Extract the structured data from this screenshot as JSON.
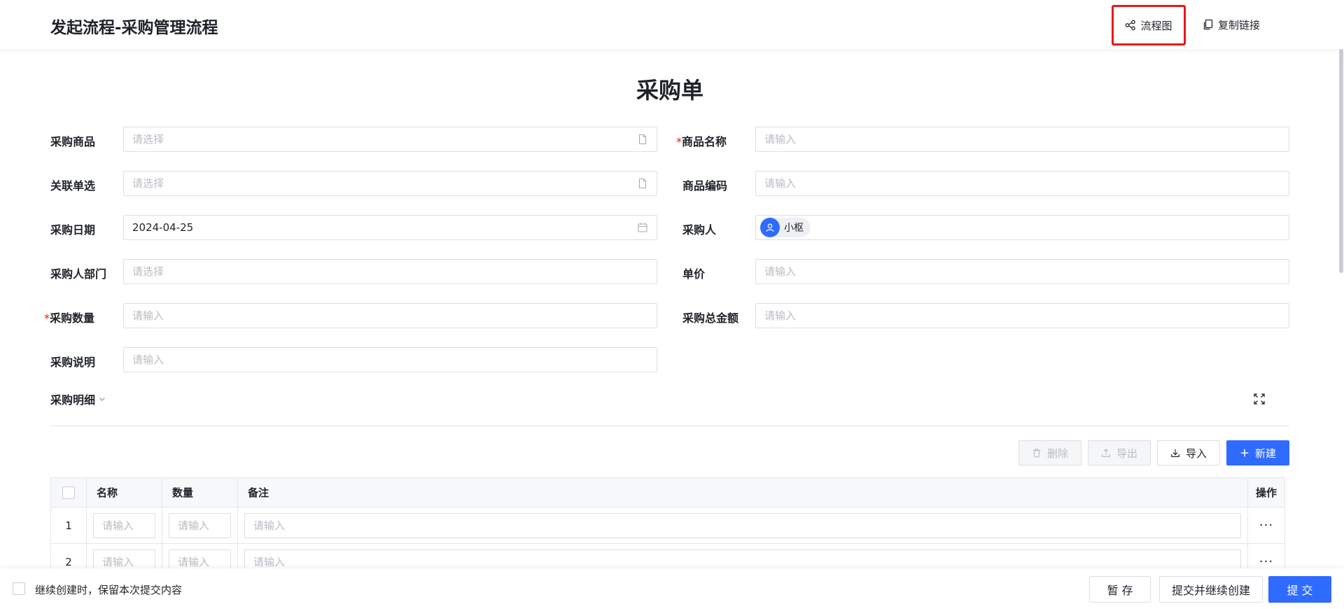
{
  "header": {
    "title": "发起流程-采购管理流程",
    "flowchart_label": "流程图",
    "copy_link_label": "复制链接"
  },
  "form": {
    "title": "采购单",
    "fields": {
      "goods": {
        "label": "采购商品",
        "placeholder": "请选择",
        "value": ""
      },
      "goods_name": {
        "label": "商品名称",
        "required": true,
        "placeholder": "请输入",
        "value": ""
      },
      "related": {
        "label": "关联单选",
        "placeholder": "请选择",
        "value": ""
      },
      "goods_code": {
        "label": "商品编码",
        "placeholder": "请输入",
        "value": ""
      },
      "date": {
        "label": "采购日期",
        "value": "2024-04-25"
      },
      "buyer": {
        "label": "采购人",
        "user": "小枢"
      },
      "dept": {
        "label": "采购人部门",
        "placeholder": "请选择",
        "value": ""
      },
      "unit_price": {
        "label": "单价",
        "placeholder": "请输入",
        "value": ""
      },
      "quantity": {
        "label": "采购数量",
        "required": true,
        "placeholder": "请输入",
        "value": ""
      },
      "total": {
        "label": "采购总金额",
        "placeholder": "请输入",
        "value": ""
      },
      "note": {
        "label": "采购说明",
        "placeholder": "请输入",
        "value": ""
      }
    },
    "required_mark": "*"
  },
  "detail": {
    "title": "采购明细",
    "toolbar": {
      "delete": "删除",
      "export": "导出",
      "import": "导入",
      "add": "新建"
    },
    "columns": [
      "名称",
      "数量",
      "备注",
      "操作"
    ],
    "rows": [
      {
        "index": "1",
        "name_placeholder": "请输入",
        "qty_placeholder": "请输入",
        "note_placeholder": "请输入",
        "op": "···"
      },
      {
        "index": "2",
        "name_placeholder": "请输入",
        "qty_placeholder": "请输入",
        "note_placeholder": "请输入",
        "op": "···"
      }
    ]
  },
  "footer": {
    "keep_label": "继续创建时，保留本次提交内容",
    "save_draft": "暂 存",
    "submit_continue": "提交并继续创建",
    "submit": "提 交"
  },
  "colors": {
    "primary": "#2f6bff",
    "required": "#e5191c",
    "highlight_border": "#e5191c"
  }
}
